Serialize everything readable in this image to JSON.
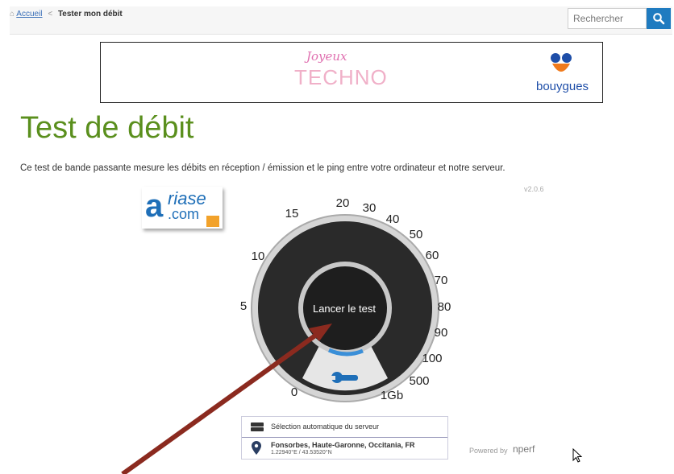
{
  "breadcrumb": {
    "home_label": "Accueil",
    "separator": "<",
    "current": "Tester mon débit"
  },
  "search": {
    "placeholder": "Rechercher"
  },
  "banner": {
    "festive_text": "Joyeux",
    "techno_text": "TECHNO",
    "brand": "bouygues"
  },
  "page": {
    "title": "Test de débit",
    "description": "Ce test de bande passante mesure les débits en réception / émission et le ping entre votre ordinateur et notre serveur.",
    "version": "v2.0.6"
  },
  "logo": {
    "text_main": "riase",
    "text_a": "a",
    "text_com": ".com"
  },
  "gauge": {
    "scale_labels": [
      "0",
      "5",
      "10",
      "15",
      "20",
      "30",
      "40",
      "50",
      "60",
      "70",
      "80",
      "90",
      "100",
      "500",
      "1Gb"
    ],
    "launch_label": "Lancer le test"
  },
  "server": {
    "auto_label": "Sélection automatique du serveur",
    "location": "Fonsorbes, Haute-Garonne, Occitania, FR",
    "coords": "1.22940°E / 43.53520°N"
  },
  "footer": {
    "powered_by": "Powered by",
    "brand": "nperf"
  },
  "colors": {
    "title_green": "#5a8f1d",
    "search_blue": "#1f7bc0",
    "arrow": "#8b2a1f",
    "gauge_blue": "#3a8fd8"
  }
}
